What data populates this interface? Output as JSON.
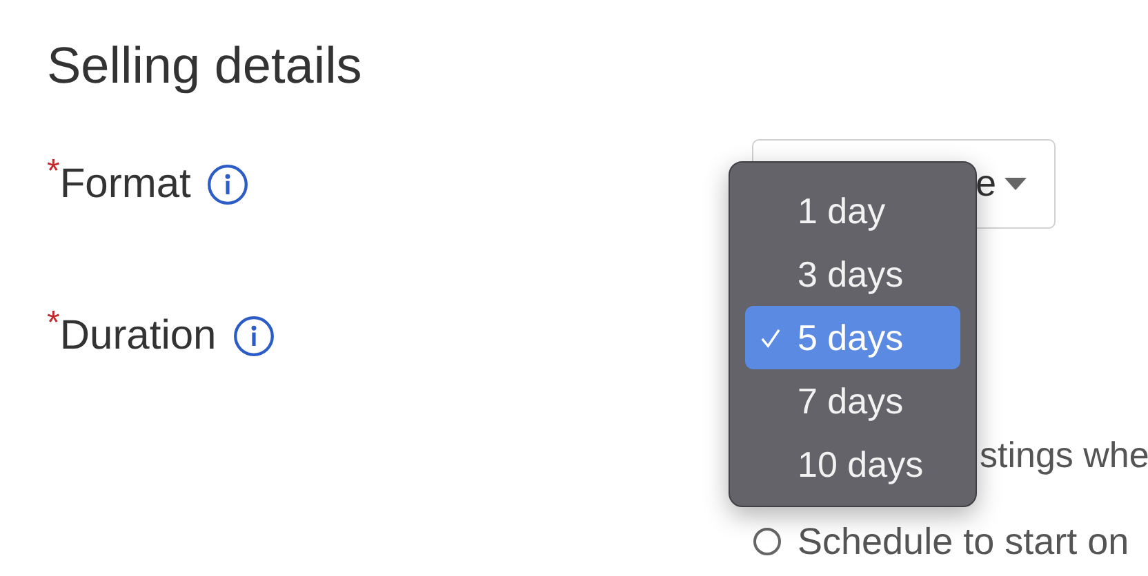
{
  "heading": "Selling details",
  "fields": [
    {
      "marker": "*",
      "label": "Format",
      "control": {
        "kind": "select",
        "value": "e"
      }
    },
    {
      "marker": "*",
      "label": "Duration"
    }
  ],
  "duration_menu": {
    "options": [
      {
        "label": "1 day",
        "selected": false
      },
      {
        "label": "3 days",
        "selected": false
      },
      {
        "label": "5 days",
        "selected": true
      },
      {
        "label": "7 days",
        "selected": false
      },
      {
        "label": "10 days",
        "selected": false
      }
    ]
  },
  "start_options": [
    {
      "kind": "text",
      "label": "stings whe"
    },
    {
      "kind": "radio",
      "label": "Schedule to start on",
      "selected": false
    }
  ]
}
